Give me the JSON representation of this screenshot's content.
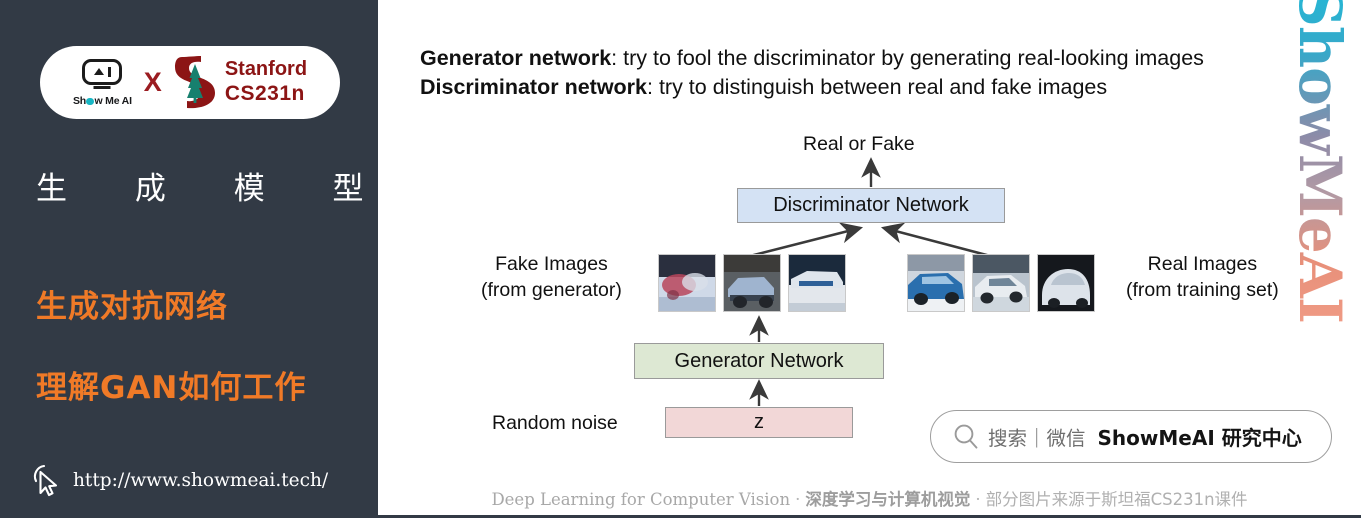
{
  "sidebar": {
    "logo": {
      "showmeai_word": "Show Me AI",
      "showmeai_o": "o",
      "showmeai_pre": "Sh",
      "showmeai_post": "w Me AI",
      "cross": "X",
      "stanford_line1": "Stanford",
      "stanford_line2": "CS231n",
      "smai_icon": "showmeai-monitor-icon",
      "stanford_icon": "stanford-tree-icon"
    },
    "title": "生 成 模 型",
    "orange_line_1": "生成对抗网络",
    "orange_line_2": "理解GAN如何工作",
    "url": "http://www.showmeai.tech/",
    "cursor_icon": "cursor-pointer-icon",
    "colors": {
      "background": "#323a45",
      "accent_orange": "#f07a27",
      "stanford_red": "#8c1515",
      "teal": "#17b6c4"
    }
  },
  "main": {
    "header": {
      "line1_bold": "Generator network",
      "line1_rest": ": try to fool the discriminator by generating real-looking images",
      "line2_bold": "Discriminator network",
      "line2_rest": ": try to distinguish between real and fake images"
    },
    "diagram": {
      "output_label": "Real or Fake",
      "discriminator_box": "Discriminator Network",
      "generator_box": "Generator Network",
      "latent_box": "z",
      "fake_label_line1": "Fake Images",
      "fake_label_line2": "(from generator)",
      "real_label_line1": "Real Images",
      "real_label_line2": "(from training set)",
      "noise_label": "Random noise",
      "colors": {
        "discriminator_fill": "#d4e2f4",
        "generator_fill": "#dde8d3",
        "latent_fill": "#f2d7d7",
        "box_border": "#9a9a9a",
        "arrow": "#3a3a3a"
      }
    },
    "watermark": "ShowMeAI",
    "search_widget": {
      "icon": "search-icon",
      "placeholder_cn": "搜索｜微信",
      "brand": "ShowMeAI 研究中心"
    },
    "footer": {
      "en": "Deep Learning for Computer Vision",
      "sep1": "·",
      "cn_bold": "深度学习与计算机视觉",
      "sep2": "·",
      "cn_normal": "部分图片来源于斯坦福CS231n课件"
    }
  }
}
